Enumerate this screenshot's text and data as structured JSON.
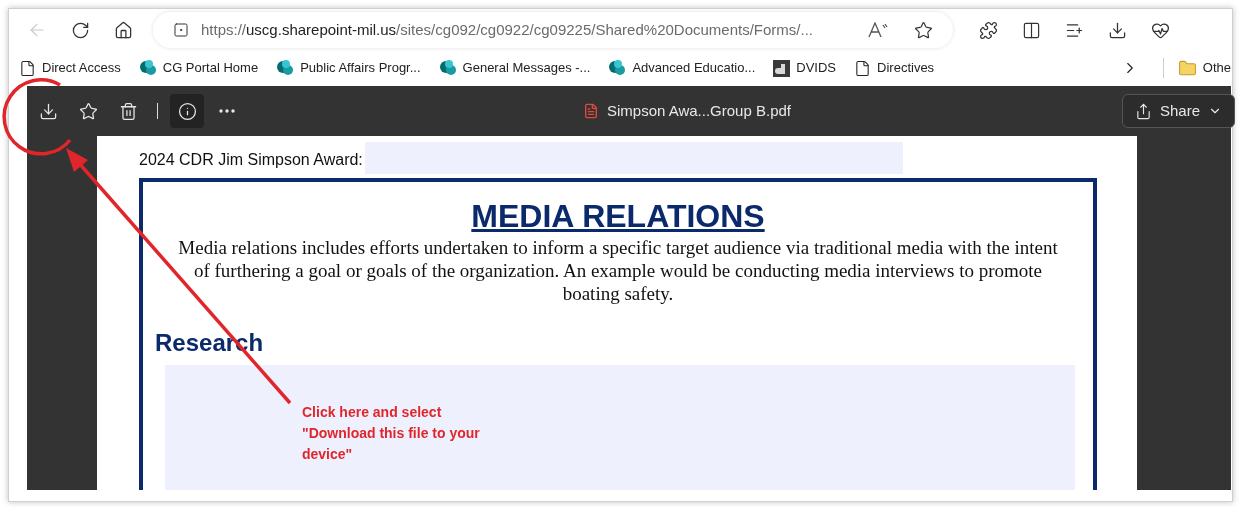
{
  "address_bar": {
    "scheme": "https://",
    "host": "uscg.sharepoint-mil.us",
    "path": "/sites/cg092/cg0922/cg09225/Shared%20Documents/Forms/..."
  },
  "bookmarks": [
    {
      "label": "Direct Access",
      "kind": "page"
    },
    {
      "label": "CG Portal  Home",
      "kind": "sharepoint"
    },
    {
      "label": "Public Affairs Progr...",
      "kind": "sharepoint"
    },
    {
      "label": "General Messages -...",
      "kind": "sharepoint"
    },
    {
      "label": "Advanced Educatio...",
      "kind": "sharepoint"
    },
    {
      "label": "DVIDS",
      "kind": "dvids"
    },
    {
      "label": "Directives",
      "kind": "page"
    }
  ],
  "other_bookmarks": "Othe",
  "pdf_toolbar": {
    "tools": [
      {
        "kind": "download",
        "selected": false
      },
      {
        "kind": "star",
        "selected": false
      },
      {
        "kind": "trash",
        "selected": false
      },
      {
        "kind": "info",
        "selected": true
      },
      {
        "kind": "more",
        "selected": false
      }
    ],
    "file_name": "Simpson Awa...Group B.pdf",
    "share": "Share"
  },
  "document": {
    "award_label": "2024 CDR Jim Simpson Award:",
    "title": "MEDIA RELATIONS",
    "description": "Media relations includes efforts undertaken to inform a specific target audience via traditional media with the intent of furthering a goal or goals of the organization. An example would be conducting media interviews to promote boating safety.",
    "section": "Research"
  },
  "annotation": {
    "lines": [
      "Click here and select",
      "\"Download this file to your",
      "device\""
    ]
  }
}
